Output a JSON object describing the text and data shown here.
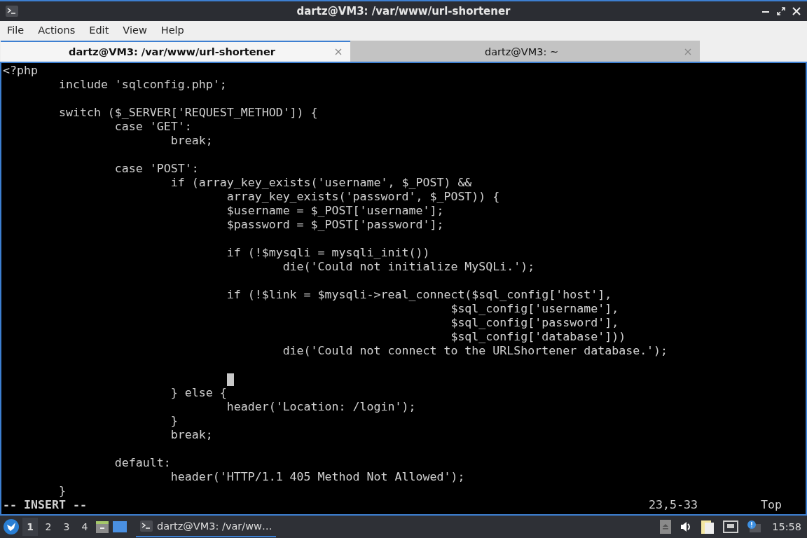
{
  "window": {
    "title": "dartz@VM3: /var/www/url-shortener"
  },
  "menu": [
    "File",
    "Actions",
    "Edit",
    "View",
    "Help"
  ],
  "tabs": [
    {
      "label": "dartz@VM3: /var/www/url-shortener",
      "selected": true
    },
    {
      "label": "dartz@VM3: ~",
      "selected": false
    }
  ],
  "editor": {
    "lines": [
      {
        "kind": "code",
        "text": "<?php"
      },
      {
        "kind": "code",
        "text": "\tinclude 'sqlconfig.php';"
      },
      {
        "kind": "blank"
      },
      {
        "kind": "code",
        "text": "\tswitch ($_SERVER['REQUEST_METHOD']) {"
      },
      {
        "kind": "code",
        "text": "\t\tcase 'GET':"
      },
      {
        "kind": "code",
        "text": "\t\t\tbreak;"
      },
      {
        "kind": "blank"
      },
      {
        "kind": "code",
        "text": "\t\tcase 'POST':"
      },
      {
        "kind": "code",
        "text": "\t\t\tif (array_key_exists('username', $_POST) &&"
      },
      {
        "kind": "code",
        "text": "\t\t\t\tarray_key_exists('password', $_POST)) {"
      },
      {
        "kind": "code",
        "text": "\t\t\t\t$username = $_POST['username'];"
      },
      {
        "kind": "code",
        "text": "\t\t\t\t$password = $_POST['password'];"
      },
      {
        "kind": "blank"
      },
      {
        "kind": "code",
        "text": "\t\t\t\tif (!$mysqli = mysqli_init())"
      },
      {
        "kind": "code",
        "text": "\t\t\t\t\tdie('Could not initialize MySQLi.');"
      },
      {
        "kind": "blank"
      },
      {
        "kind": "code",
        "text": "\t\t\t\tif (!$link = $mysqli->real_connect($sql_config['host'],"
      },
      {
        "kind": "code",
        "text": "\t\t\t\t\t\t\t\t$sql_config['username'],"
      },
      {
        "kind": "code",
        "text": "\t\t\t\t\t\t\t\t$sql_config['password'],"
      },
      {
        "kind": "code",
        "text": "\t\t\t\t\t\t\t\t$sql_config['database']))"
      },
      {
        "kind": "code",
        "text": "\t\t\t\t\tdie('Could not connect to the URLShortener database.');"
      },
      {
        "kind": "blank"
      },
      {
        "kind": "cursor"
      },
      {
        "kind": "code",
        "text": "\t\t\t} else {"
      },
      {
        "kind": "code",
        "text": "\t\t\t\theader('Location: /login');"
      },
      {
        "kind": "code",
        "text": "\t\t\t}"
      },
      {
        "kind": "code",
        "text": "\t\t\tbreak;"
      },
      {
        "kind": "blank"
      },
      {
        "kind": "code",
        "text": "\t\tdefault:"
      },
      {
        "kind": "code",
        "text": "\t\t\theader('HTTP/1.1 405 Method Not Allowed');"
      },
      {
        "kind": "code",
        "text": "\t}"
      }
    ],
    "status": {
      "mode": "-- INSERT --",
      "position": "23,5-33",
      "scroll": "Top"
    }
  },
  "taskbar": {
    "workspaces": [
      {
        "label": "1",
        "selected": true
      },
      {
        "label": "2",
        "selected": false
      },
      {
        "label": "3",
        "selected": false
      },
      {
        "label": "4",
        "selected": false
      }
    ],
    "task": "dartz@VM3: /var/ww…",
    "clock": "15:58"
  }
}
